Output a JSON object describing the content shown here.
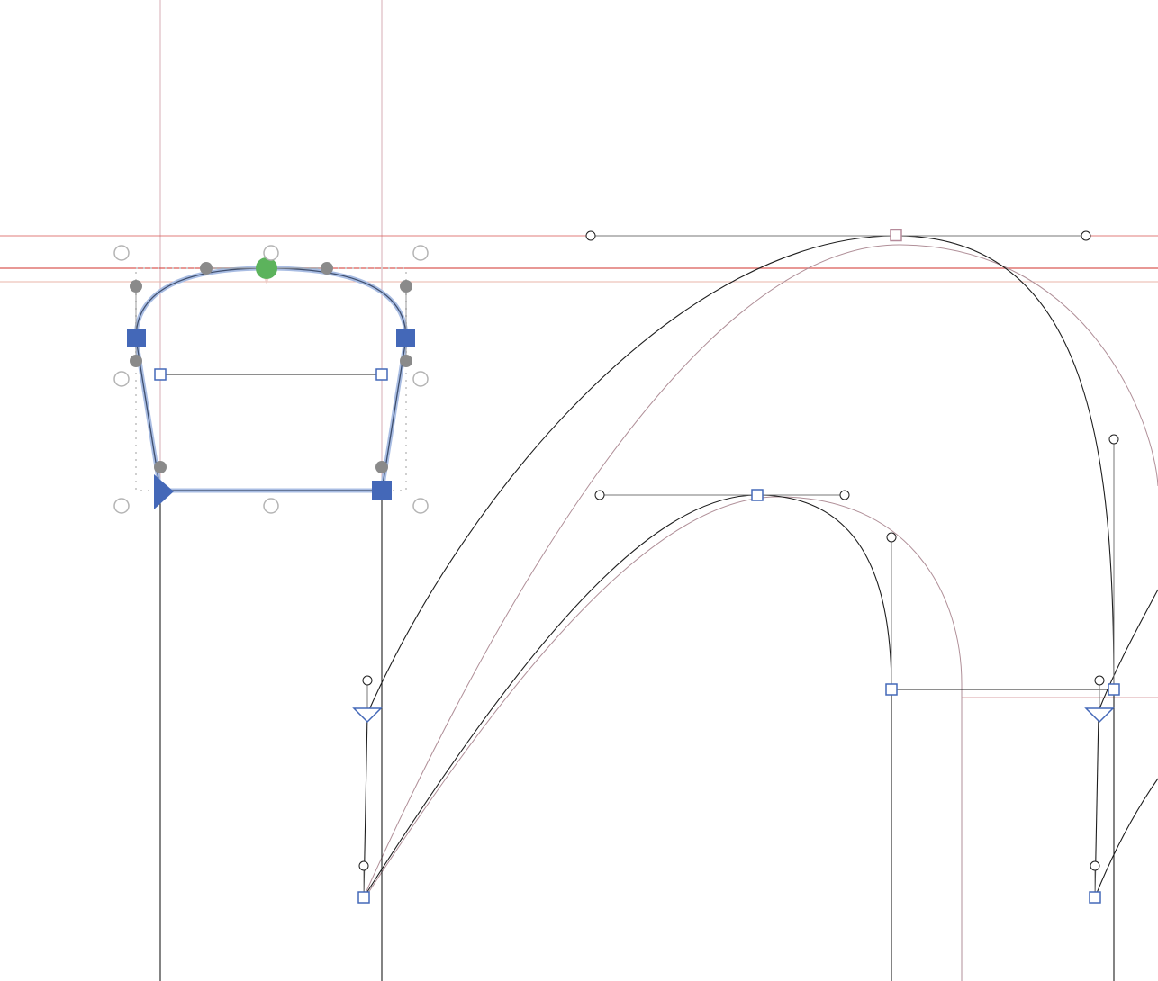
{
  "editor": {
    "view": "glyph-outline-canvas",
    "colors": {
      "guideline": "#d9534f",
      "guideline_light": "#e8b4a8",
      "background_outline": "#b08f98",
      "outline": "#1e1e1e",
      "selected_outline": "#5a74a8",
      "selected_node": "#4468b8",
      "start_point": "#4468b8",
      "off_curve_selected": "#8a8a8a",
      "center_handle": "#5cb35c",
      "bbox_handle": "#b4b4b4",
      "handle_line": "#666666"
    },
    "icons": {
      "start_point": "triangle-right",
      "smooth_node": "circle",
      "corner_node": "square",
      "tangent_node": "triangle-down",
      "rotate_handle": "circle-filled"
    }
  }
}
